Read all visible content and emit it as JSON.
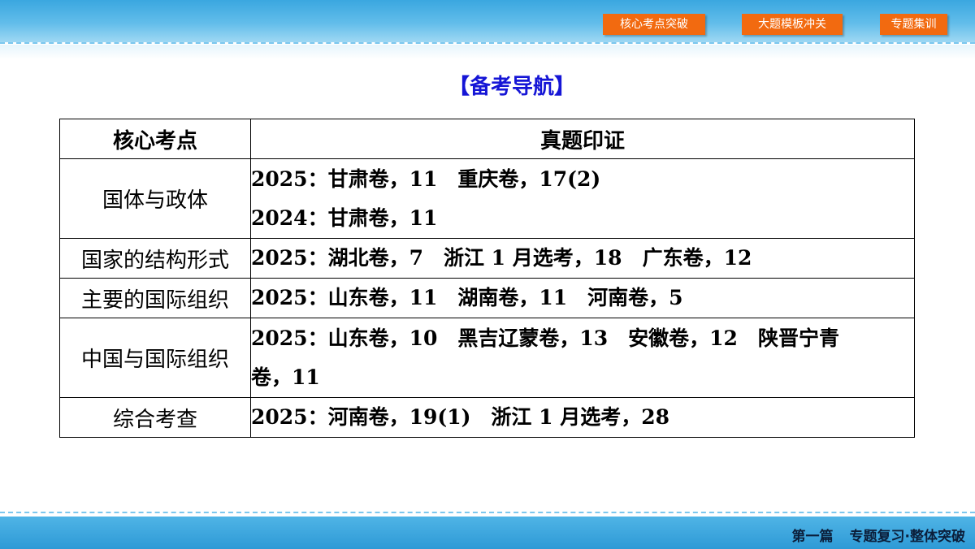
{
  "nav": {
    "buttons": [
      "核心考点突破",
      "大题模板冲关",
      "专题集训"
    ]
  },
  "heading": "【备考导航】",
  "table": {
    "headers": [
      "核心考点",
      "真题印证"
    ],
    "rows": [
      {
        "topic": "国体与政体",
        "lines": [
          "2025：甘肃卷，11　重庆卷，17(2)",
          "2024：甘肃卷，11"
        ]
      },
      {
        "topic": "国家的结构形式",
        "lines": [
          "2025：湖北卷，7　浙江 1 月选考，18　广东卷，12"
        ]
      },
      {
        "topic": "主要的国际组织",
        "lines": [
          "2025：山东卷，11　湖南卷，11　河南卷，5"
        ]
      },
      {
        "topic": "中国与国际组织",
        "lines": [
          "2025：山东卷，10　黑吉辽蒙卷，13　安徽卷，12　陕晋宁青",
          "卷，11"
        ]
      },
      {
        "topic": "综合考查",
        "lines": [
          "2025：河南卷，19(1)　浙江 1 月选考，28"
        ]
      }
    ]
  },
  "footer": {
    "part": "第一篇",
    "title": "专题复习·整体突破"
  },
  "colors": {
    "nav_button": "#f26a10",
    "heading": "#1515d6",
    "bar": "#3aa7e0"
  }
}
